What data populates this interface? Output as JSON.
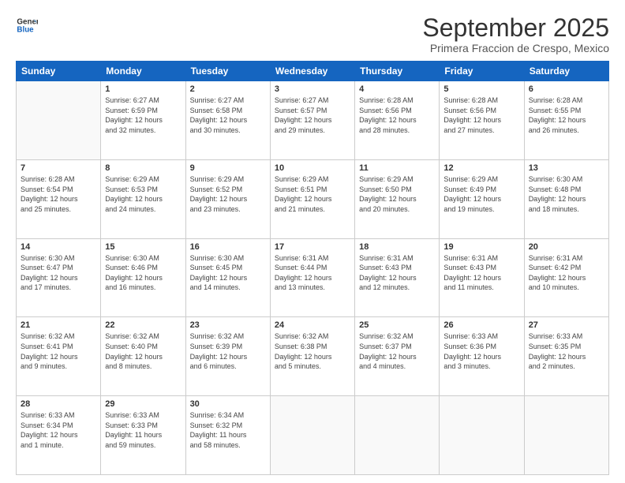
{
  "header": {
    "logo_line1": "General",
    "logo_line2": "Blue",
    "month": "September 2025",
    "location": "Primera Fraccion de Crespo, Mexico"
  },
  "days_of_week": [
    "Sunday",
    "Monday",
    "Tuesday",
    "Wednesday",
    "Thursday",
    "Friday",
    "Saturday"
  ],
  "weeks": [
    [
      {
        "day": "",
        "info": ""
      },
      {
        "day": "1",
        "info": "Sunrise: 6:27 AM\nSunset: 6:59 PM\nDaylight: 12 hours\nand 32 minutes."
      },
      {
        "day": "2",
        "info": "Sunrise: 6:27 AM\nSunset: 6:58 PM\nDaylight: 12 hours\nand 30 minutes."
      },
      {
        "day": "3",
        "info": "Sunrise: 6:27 AM\nSunset: 6:57 PM\nDaylight: 12 hours\nand 29 minutes."
      },
      {
        "day": "4",
        "info": "Sunrise: 6:28 AM\nSunset: 6:56 PM\nDaylight: 12 hours\nand 28 minutes."
      },
      {
        "day": "5",
        "info": "Sunrise: 6:28 AM\nSunset: 6:56 PM\nDaylight: 12 hours\nand 27 minutes."
      },
      {
        "day": "6",
        "info": "Sunrise: 6:28 AM\nSunset: 6:55 PM\nDaylight: 12 hours\nand 26 minutes."
      }
    ],
    [
      {
        "day": "7",
        "info": "Sunrise: 6:28 AM\nSunset: 6:54 PM\nDaylight: 12 hours\nand 25 minutes."
      },
      {
        "day": "8",
        "info": "Sunrise: 6:29 AM\nSunset: 6:53 PM\nDaylight: 12 hours\nand 24 minutes."
      },
      {
        "day": "9",
        "info": "Sunrise: 6:29 AM\nSunset: 6:52 PM\nDaylight: 12 hours\nand 23 minutes."
      },
      {
        "day": "10",
        "info": "Sunrise: 6:29 AM\nSunset: 6:51 PM\nDaylight: 12 hours\nand 21 minutes."
      },
      {
        "day": "11",
        "info": "Sunrise: 6:29 AM\nSunset: 6:50 PM\nDaylight: 12 hours\nand 20 minutes."
      },
      {
        "day": "12",
        "info": "Sunrise: 6:29 AM\nSunset: 6:49 PM\nDaylight: 12 hours\nand 19 minutes."
      },
      {
        "day": "13",
        "info": "Sunrise: 6:30 AM\nSunset: 6:48 PM\nDaylight: 12 hours\nand 18 minutes."
      }
    ],
    [
      {
        "day": "14",
        "info": "Sunrise: 6:30 AM\nSunset: 6:47 PM\nDaylight: 12 hours\nand 17 minutes."
      },
      {
        "day": "15",
        "info": "Sunrise: 6:30 AM\nSunset: 6:46 PM\nDaylight: 12 hours\nand 16 minutes."
      },
      {
        "day": "16",
        "info": "Sunrise: 6:30 AM\nSunset: 6:45 PM\nDaylight: 12 hours\nand 14 minutes."
      },
      {
        "day": "17",
        "info": "Sunrise: 6:31 AM\nSunset: 6:44 PM\nDaylight: 12 hours\nand 13 minutes."
      },
      {
        "day": "18",
        "info": "Sunrise: 6:31 AM\nSunset: 6:43 PM\nDaylight: 12 hours\nand 12 minutes."
      },
      {
        "day": "19",
        "info": "Sunrise: 6:31 AM\nSunset: 6:43 PM\nDaylight: 12 hours\nand 11 minutes."
      },
      {
        "day": "20",
        "info": "Sunrise: 6:31 AM\nSunset: 6:42 PM\nDaylight: 12 hours\nand 10 minutes."
      }
    ],
    [
      {
        "day": "21",
        "info": "Sunrise: 6:32 AM\nSunset: 6:41 PM\nDaylight: 12 hours\nand 9 minutes."
      },
      {
        "day": "22",
        "info": "Sunrise: 6:32 AM\nSunset: 6:40 PM\nDaylight: 12 hours\nand 8 minutes."
      },
      {
        "day": "23",
        "info": "Sunrise: 6:32 AM\nSunset: 6:39 PM\nDaylight: 12 hours\nand 6 minutes."
      },
      {
        "day": "24",
        "info": "Sunrise: 6:32 AM\nSunset: 6:38 PM\nDaylight: 12 hours\nand 5 minutes."
      },
      {
        "day": "25",
        "info": "Sunrise: 6:32 AM\nSunset: 6:37 PM\nDaylight: 12 hours\nand 4 minutes."
      },
      {
        "day": "26",
        "info": "Sunrise: 6:33 AM\nSunset: 6:36 PM\nDaylight: 12 hours\nand 3 minutes."
      },
      {
        "day": "27",
        "info": "Sunrise: 6:33 AM\nSunset: 6:35 PM\nDaylight: 12 hours\nand 2 minutes."
      }
    ],
    [
      {
        "day": "28",
        "info": "Sunrise: 6:33 AM\nSunset: 6:34 PM\nDaylight: 12 hours\nand 1 minute."
      },
      {
        "day": "29",
        "info": "Sunrise: 6:33 AM\nSunset: 6:33 PM\nDaylight: 11 hours\nand 59 minutes."
      },
      {
        "day": "30",
        "info": "Sunrise: 6:34 AM\nSunset: 6:32 PM\nDaylight: 11 hours\nand 58 minutes."
      },
      {
        "day": "",
        "info": ""
      },
      {
        "day": "",
        "info": ""
      },
      {
        "day": "",
        "info": ""
      },
      {
        "day": "",
        "info": ""
      }
    ]
  ]
}
